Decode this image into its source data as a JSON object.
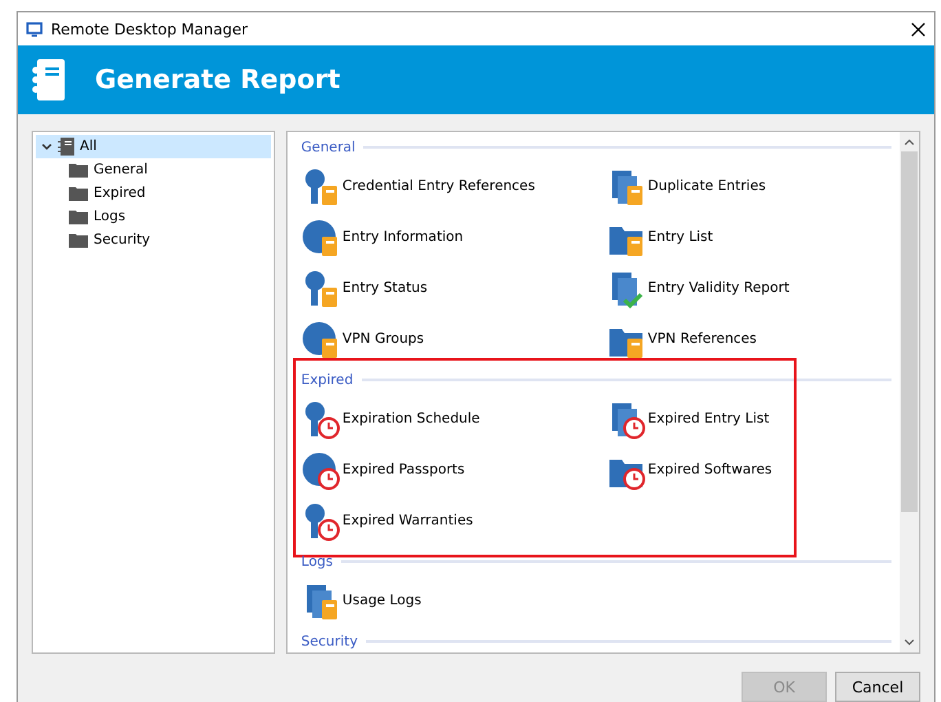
{
  "window": {
    "title": "Remote Desktop Manager"
  },
  "header": {
    "title": "Generate Report"
  },
  "tree": {
    "label": "All",
    "expanded": true,
    "selected": true,
    "children": [
      {
        "label": "General",
        "selected": false
      },
      {
        "label": "Expired",
        "selected": false
      },
      {
        "label": "Logs",
        "selected": false
      },
      {
        "label": "Security",
        "selected": false
      }
    ]
  },
  "sections": [
    {
      "title": "General",
      "highlighted": false,
      "items": [
        {
          "label": "Credential Entry References",
          "kind": "report"
        },
        {
          "label": "Duplicate Entries",
          "kind": "report"
        },
        {
          "label": "Entry Information",
          "kind": "report"
        },
        {
          "label": "Entry List",
          "kind": "report"
        },
        {
          "label": "Entry Status",
          "kind": "report"
        },
        {
          "label": "Entry Validity Report",
          "kind": "check"
        },
        {
          "label": "VPN Groups",
          "kind": "report"
        },
        {
          "label": "VPN References",
          "kind": "report"
        }
      ]
    },
    {
      "title": "Expired",
      "highlighted": true,
      "items": [
        {
          "label": "Expiration Schedule",
          "kind": "expired"
        },
        {
          "label": "Expired Entry List",
          "kind": "expired"
        },
        {
          "label": "Expired Passports",
          "kind": "expired"
        },
        {
          "label": "Expired Softwares",
          "kind": "expired"
        },
        {
          "label": "Expired Warranties",
          "kind": "expired"
        }
      ]
    },
    {
      "title": "Logs",
      "highlighted": false,
      "items": [
        {
          "label": "Usage Logs",
          "kind": "report"
        }
      ]
    },
    {
      "title": "Security",
      "highlighted": false
    }
  ],
  "buttons": [
    {
      "label": "OK",
      "disabled": true
    },
    {
      "label": "Cancel",
      "disabled": false
    }
  ]
}
